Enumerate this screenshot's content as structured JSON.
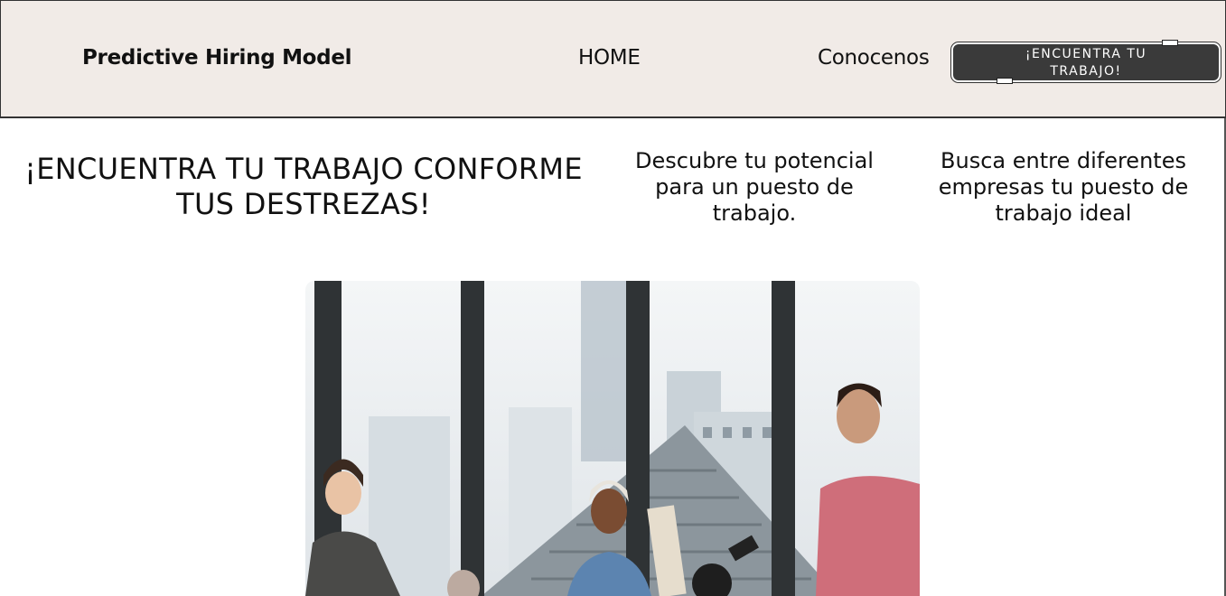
{
  "header": {
    "brand": "Predictive Hiring Model",
    "nav": [
      {
        "label": "HOME"
      },
      {
        "label": "Conocenos"
      }
    ],
    "cta_label": "¡ENCUENTRA TU TRABAJO!"
  },
  "hero": {
    "title": "¡ENCUENTRA TU TRABAJO CONFORME TUS DESTREZAS!",
    "features": [
      {
        "text": "Descubre tu potencial para un puesto de trabajo."
      },
      {
        "text": "Busca entre diferentes empresas tu puesto de trabajo ideal"
      }
    ]
  }
}
